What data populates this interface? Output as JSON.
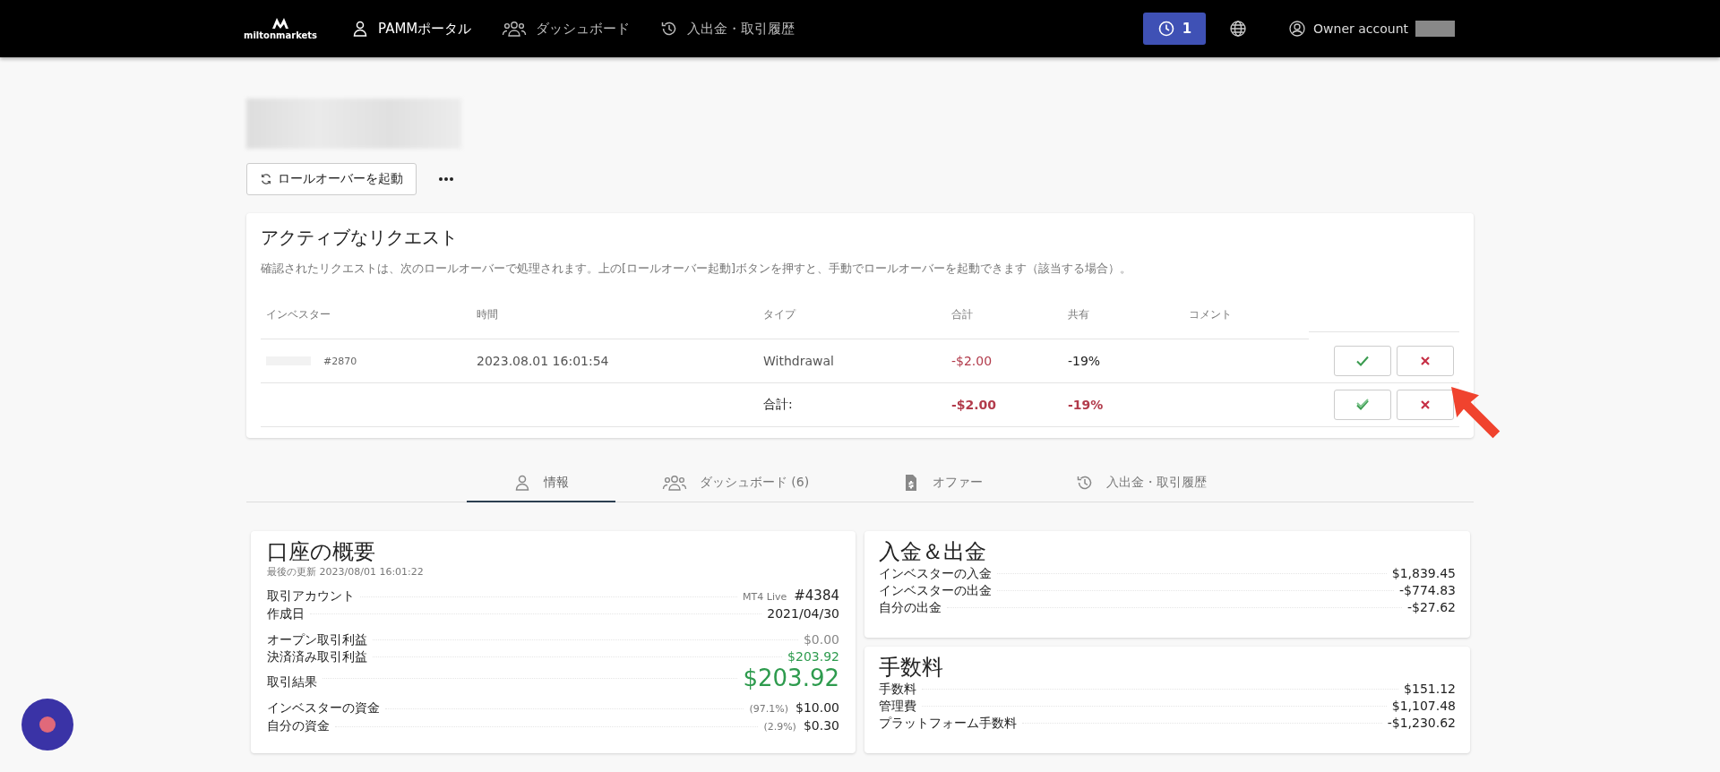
{
  "nav": {
    "logo": "miltonmarkets",
    "items": [
      {
        "label": "PAMMポータル",
        "selected": true
      },
      {
        "label": "ダッシュボード",
        "selected": false
      },
      {
        "label": "入出金・取引履歴",
        "selected": false
      }
    ],
    "notifications": "1",
    "account": "Owner account"
  },
  "rollover_button": "ロールオーバーを起動",
  "requests": {
    "title": "アクティブなリクエスト",
    "description": "確認されたリクエストは、次のロールオーバーで処理されます。上の[ロールオーバー起動]ボタンを押すと、手動でロールオーバーを起動できます（該当する場合）。",
    "columns": [
      "インベスター",
      "時間",
      "タイプ",
      "合計",
      "共有",
      "コメント"
    ],
    "rows": [
      {
        "investor": "#2870",
        "time": "2023.08.01 16:01:54",
        "type": "Withdrawal",
        "total": "-$2.00",
        "share": "-19%"
      }
    ],
    "summary": {
      "label": "合計:",
      "total": "-$2.00",
      "share": "-19%"
    }
  },
  "tabs": [
    {
      "label": "情報",
      "selected": true
    },
    {
      "label": "ダッシュボード (6)",
      "selected": false
    },
    {
      "label": "オファー",
      "selected": false
    },
    {
      "label": "入出金・取引履歴",
      "selected": false
    }
  ],
  "overview": {
    "title": "口座の概要",
    "updated": "最後の更新 2023/08/01 16:01:22",
    "groups": [
      [
        {
          "label": "取引アカウント",
          "note": "MT4 Live",
          "value": "#4384",
          "kind": "plain"
        },
        {
          "label": "作成日",
          "value": "2021/04/30",
          "kind": "plain"
        }
      ],
      [
        {
          "label": "オープン取引利益",
          "value": "$0.00",
          "kind": "muted"
        },
        {
          "label": "決済済み取引利益",
          "value": "$203.92",
          "kind": "positive"
        },
        {
          "label": "取引結果",
          "value": "$203.92",
          "kind": "positive_large"
        }
      ],
      [
        {
          "label": "インベスターの資金",
          "note": "(97.1%)",
          "value": "$10.00",
          "kind": "plain"
        },
        {
          "label": "自分の資金",
          "note": "(2.9%)",
          "value": "$0.30",
          "kind": "plain"
        }
      ]
    ]
  },
  "deposits": {
    "title": "入金＆出金",
    "rows": [
      {
        "label": "インベスターの入金",
        "value": "$1,839.45"
      },
      {
        "label": "インベスターの出金",
        "value": "-$774.83"
      },
      {
        "label": "自分の出金",
        "value": "-$27.62"
      }
    ]
  },
  "fees": {
    "title": "手数料",
    "rows": [
      {
        "label": "手数料",
        "value": "$151.12"
      },
      {
        "label": "管理費",
        "value": "$1,107.48"
      },
      {
        "label": "プラットフォーム手数料",
        "value": "-$1,230.62"
      }
    ]
  }
}
